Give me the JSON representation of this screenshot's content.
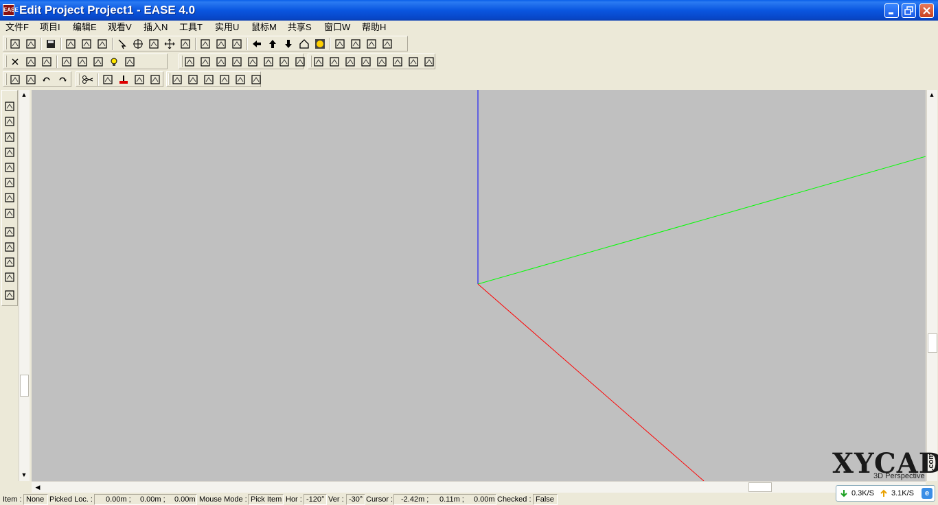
{
  "window": {
    "title": "Edit Project Project1 - EASE 4.0",
    "icon_label": "EASE"
  },
  "menu": [
    {
      "label": "文件F"
    },
    {
      "label": "项目I"
    },
    {
      "label": "编辑E"
    },
    {
      "label": "观看V"
    },
    {
      "label": "插入N"
    },
    {
      "label": "工具T"
    },
    {
      "label": "实用U"
    },
    {
      "label": "鼠标M"
    },
    {
      "label": "共享S"
    },
    {
      "label": "窗口W"
    },
    {
      "label": "帮助H"
    }
  ],
  "toolbars": {
    "row1_icons": [
      "new-project-icon",
      "open-project-icon",
      "save-icon",
      "print-icon",
      "print-preview-icon",
      "export-icon",
      "pointer-icon",
      "crosshair-icon",
      "copy-icon",
      "move-icon",
      "zoom-extents-icon",
      "zoom-window-icon",
      "grid-icon",
      "render-icon",
      "arrow-left-icon",
      "arrow-up-icon",
      "arrow-down-icon",
      "home-icon",
      "light-render-icon",
      "speaker-a-icon",
      "speaker-b-icon",
      "light-a-icon",
      "speaker-c-icon"
    ],
    "row2_icons": [
      "delete-icon",
      "vertex-icon",
      "face-icon",
      "speaker-icon",
      "seat-icon",
      "listener-icon",
      "light-icon",
      "audience-icon",
      "select-vertex-icon",
      "select-edge-icon",
      "select-face-icon",
      "select-speaker-icon",
      "select-seat-icon",
      "select-listener-icon",
      "select-light-icon",
      "select-audience-icon",
      "edit-vertex-icon",
      "edit-edge-icon",
      "edit-face-icon",
      "edit-speaker-icon",
      "edit-seat-icon",
      "edit-listener-icon",
      "edit-light-icon",
      "edit-audience-icon"
    ],
    "row3_icons": [
      "new-room-icon",
      "open-room-icon",
      "undo-icon",
      "redo-icon",
      "cut-icon",
      "check-icon",
      "paint-icon",
      "binocular-icon",
      "hand-icon",
      "view-top-icon",
      "view-front-icon",
      "view-side-icon",
      "view-3d-icon",
      "view-center-icon",
      "view-tile-icon"
    ]
  },
  "left_toolbar_icons": [
    "insert-vertex-icon",
    "insert-edge-icon",
    "insert-face-icon",
    "insert-speaker-icon",
    "insert-seat-icon",
    "insert-listener-icon",
    "insert-light-icon",
    "insert-audience-icon",
    "insert-box-icon",
    "insert-wall-icon",
    "insert-stair-icon",
    "insert-cylinder-icon",
    "insert-room-icon"
  ],
  "viewport": {
    "background": "#c0c0c0",
    "axes": {
      "z_color": "#0000ff",
      "y_color": "#00ff00",
      "x_color": "#ff0000"
    }
  },
  "status": {
    "item_label": "Item :",
    "item_value": "None",
    "picked_label": "Picked Loc. :",
    "picked_x": "0.00m ;",
    "picked_y": "0.00m ;",
    "picked_z": "0.00m",
    "mouse_mode_label": "Mouse Mode :",
    "mouse_mode_value": "Pick Item",
    "hor_label": "Hor :",
    "hor_value": "-120°",
    "ver_label": "Ver :",
    "ver_value": "-30°",
    "cursor_label": "Cursor :",
    "cursor_x": "-2.42m ;",
    "cursor_y": "0.11m ;",
    "cursor_z": "0.00m",
    "checked_label": "Checked :",
    "checked_value": "False"
  },
  "watermark": {
    "text": "XYCAD",
    "sub": "3D Perspective",
    "com": ".com"
  },
  "netspeed": {
    "down": "0.3K/S",
    "up": "3.1K/S"
  }
}
